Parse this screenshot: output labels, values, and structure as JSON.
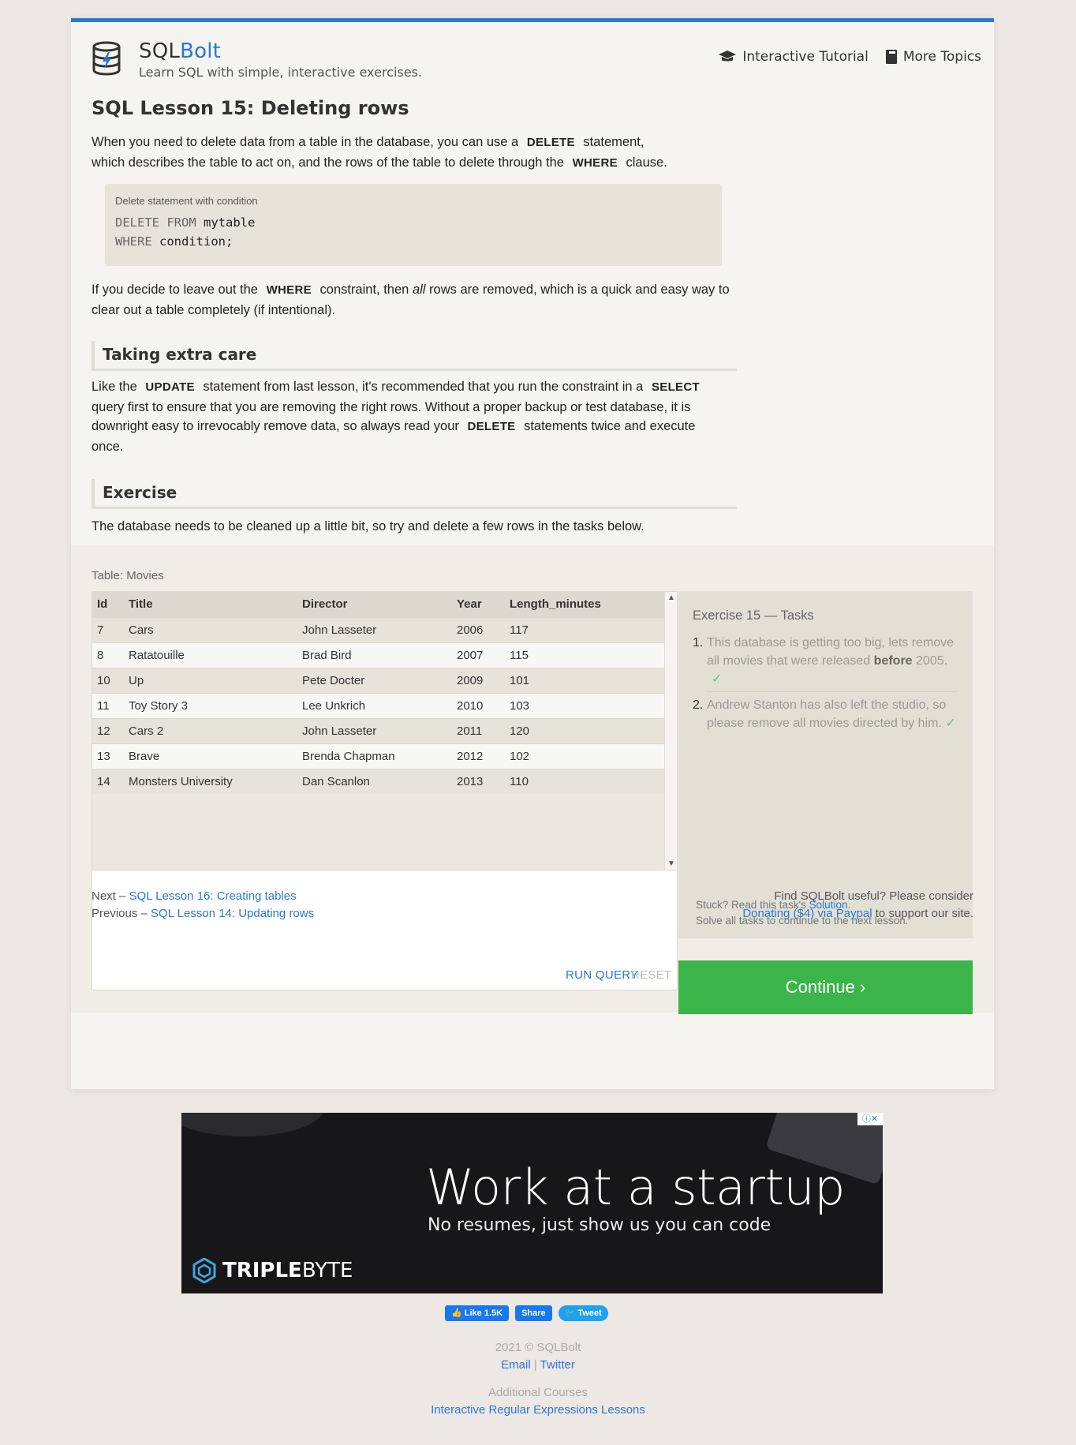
{
  "header": {
    "brand_a": "SQL",
    "brand_b": "Bolt",
    "tagline": "Learn SQL with simple, interactive exercises.",
    "nav": [
      {
        "label": "Interactive Tutorial",
        "icon": "graduation-cap-icon"
      },
      {
        "label": "More Topics",
        "icon": "book-icon"
      }
    ]
  },
  "lesson": {
    "title": "SQL Lesson 15: Deleting rows",
    "p1_a": "When you need to delete data from a table in the database, you can use a",
    "p1_kw1": "DELETE",
    "p1_b": "statement, which describes the table to act on, and the rows of the table to delete through the",
    "p1_kw2": "WHERE",
    "p1_c": "clause.",
    "code_caption": "Delete statement with condition",
    "code_line1_kw": "DELETE FROM",
    "code_line1_rest": "mytable",
    "code_line2_kw": "WHERE",
    "code_line2_rest": "condition;",
    "p2_a": "If you decide to leave out the",
    "p2_kw": "WHERE",
    "p2_b": "constraint, then",
    "p2_em": "all",
    "p2_c": "rows are removed, which is a quick and easy way to clear out a table completely (if intentional).",
    "subhead1": "Taking extra care",
    "p3_a": "Like the",
    "p3_kw1": "UPDATE",
    "p3_b": "statement from last lesson, it's recommended that you run the constraint in a",
    "p3_kw2": "SELECT",
    "p3_c": "query first to ensure that you are removing the right rows. Without a proper backup or test database, it is downright easy to irrevocably remove data, so always read your",
    "p3_kw3": "DELETE",
    "p3_d": "statements twice and execute once.",
    "subhead2": "Exercise",
    "p4": "The database needs to be cleaned up a little bit, so try and delete a few rows in the tasks below."
  },
  "exercise": {
    "table_caption": "Table: Movies",
    "columns": [
      "Id",
      "Title",
      "Director",
      "Year",
      "Length_minutes"
    ],
    "rows": [
      [
        "7",
        "Cars",
        "John Lasseter",
        "2006",
        "117"
      ],
      [
        "8",
        "Ratatouille",
        "Brad Bird",
        "2007",
        "115"
      ],
      [
        "10",
        "Up",
        "Pete Docter",
        "2009",
        "101"
      ],
      [
        "11",
        "Toy Story 3",
        "Lee Unkrich",
        "2010",
        "103"
      ],
      [
        "12",
        "Cars 2",
        "John Lasseter",
        "2011",
        "120"
      ],
      [
        "13",
        "Brave",
        "Brenda Chapman",
        "2012",
        "102"
      ],
      [
        "14",
        "Monsters University",
        "Dan Scanlon",
        "2013",
        "110"
      ]
    ],
    "query_value": "",
    "run_label": "RUN QUERY",
    "reset_label": "RESET",
    "tasks_title": "Exercise 15 — Tasks",
    "task1_num": "1.",
    "task1_a": "This database is getting too big, lets remove all movies that were released",
    "task1_b": "before",
    "task1_c": "2005.",
    "task2_num": "2.",
    "task2_text": "Andrew Stanton has also left the studio, so please remove all movies directed by him.",
    "check": "✓",
    "stuck_a": "Stuck? Read this task's",
    "stuck_link": "Solution",
    "stuck_dot": ".",
    "stuck_b": "Solve all tasks to continue to the next lesson.",
    "continue_label": "Continue ›"
  },
  "footer": {
    "next_prefix": "Next –",
    "next_link": "SQL Lesson 16: Creating tables",
    "prev_prefix": "Previous –",
    "prev_link": "SQL Lesson 14: Updating rows",
    "support_a": "Find SQLBolt useful? Please consider",
    "support_link": "Donating ($4) via Paypal",
    "support_b": "to support our site."
  },
  "ad": {
    "headline": "Work at a startup",
    "sub": "No resumes, just show us you can code",
    "logo_bold": "TRIPLE",
    "logo_rest": "BYTE"
  },
  "social": {
    "like": "Like 1.5K",
    "share": "Share",
    "tweet": "Tweet"
  },
  "page_footer": {
    "copyright": "2021 © SQLBolt",
    "email": "Email",
    "sep": "|",
    "twitter": "Twitter",
    "courses_label": "Additional Courses",
    "courses_link": "Interactive Regular Expressions Lessons"
  },
  "colors": {
    "accent": "#2a78d6",
    "continue": "#3bb54a",
    "background": "#ede8e4"
  }
}
